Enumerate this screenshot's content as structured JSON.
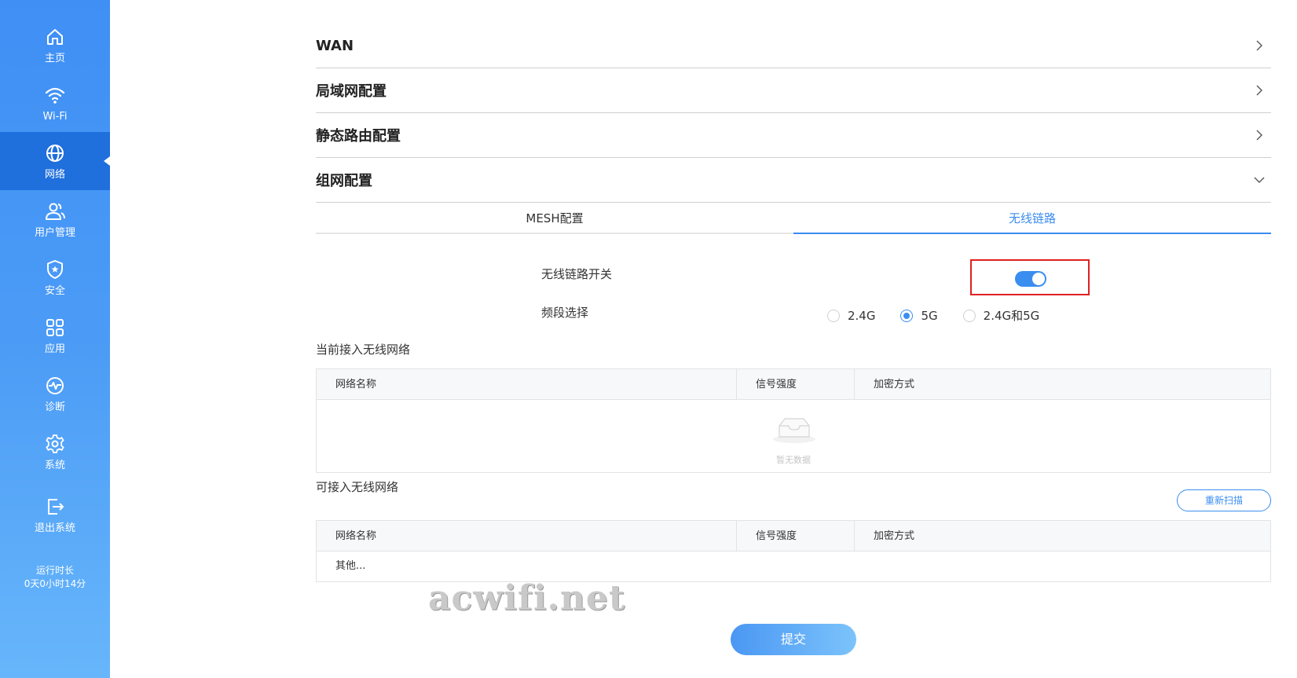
{
  "sidebar": {
    "items": [
      {
        "label": "主页",
        "icon": "home-icon"
      },
      {
        "label": "Wi-Fi",
        "icon": "wifi-icon"
      },
      {
        "label": "网络",
        "icon": "globe-icon",
        "active": true
      },
      {
        "label": "用户管理",
        "icon": "users-icon"
      },
      {
        "label": "安全",
        "icon": "shield-icon"
      },
      {
        "label": "应用",
        "icon": "apps-icon"
      },
      {
        "label": "诊断",
        "icon": "diagnose-icon"
      },
      {
        "label": "系统",
        "icon": "gear-icon"
      },
      {
        "label": "退出系统",
        "icon": "logout-icon"
      }
    ],
    "uptime_label": "运行时长",
    "uptime_value": "0天0小时14分"
  },
  "sections": {
    "wan": "WAN",
    "lan": "局域网配置",
    "static_route": "静态路由配置",
    "mesh": "组网配置"
  },
  "tabs": {
    "mesh_config": "MESH配置",
    "wireless_link": "无线链路",
    "active": "wireless_link"
  },
  "form": {
    "switch_label": "无线链路开关",
    "switch_on": true,
    "band_label": "频段选择",
    "band_options": [
      "2.4G",
      "5G",
      "2.4G和5G"
    ],
    "band_selected": "5G"
  },
  "current_network": {
    "title": "当前接入无线网络",
    "headers": [
      "网络名称",
      "信号强度",
      "加密方式"
    ],
    "empty_text": "暂无数据"
  },
  "available_network": {
    "title": "可接入无线网络",
    "rescan_label": "重新扫描",
    "headers": [
      "网络名称",
      "信号强度",
      "加密方式"
    ],
    "rows": [
      "其他..."
    ]
  },
  "submit_label": "提交",
  "watermark": "acwifi.net",
  "colors": {
    "accent": "#3a8ef0",
    "sidebar_active": "#1f6fdd",
    "highlight_box": "#e02020"
  }
}
